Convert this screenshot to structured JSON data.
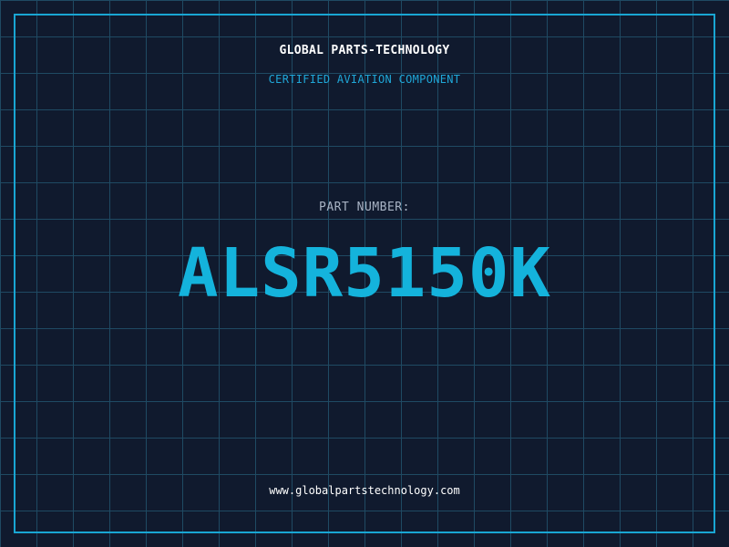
{
  "header": {
    "company": "GLOBAL PARTS-TECHNOLOGY",
    "subtitle": "CERTIFIED AVIATION COMPONENT"
  },
  "part": {
    "label": "PART NUMBER:",
    "number": "ALSR5150K"
  },
  "footer": {
    "website": "www.globalpartstechnology.com"
  },
  "colors": {
    "background": "#101a2e",
    "grid": "#1f4a63",
    "accent": "#19a6d3",
    "text": "#ffffff"
  }
}
